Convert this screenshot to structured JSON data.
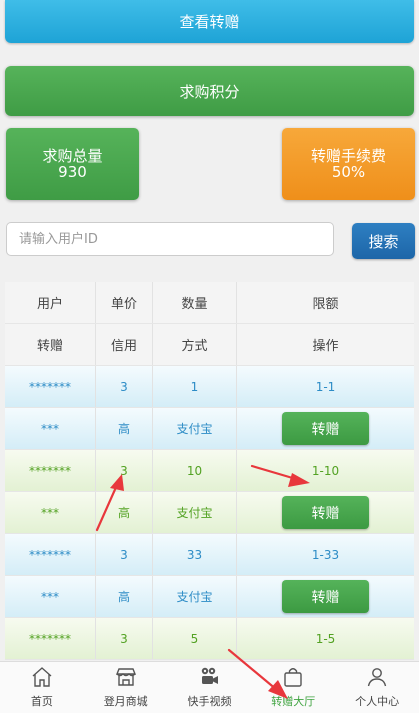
{
  "top": {
    "view_label": "查看转赠",
    "buy_label": "求购积分"
  },
  "cards": {
    "total_label": "求购总量",
    "total_value": "930",
    "fee_label": "转赠手续费",
    "fee_value": "50%"
  },
  "search": {
    "placeholder": "请输入用户ID",
    "button": "搜索"
  },
  "table": {
    "header1": [
      "用户",
      "单价",
      "数量",
      "限额"
    ],
    "header2": [
      "转赠",
      "信用",
      "方式",
      "操作"
    ],
    "entries": [
      {
        "user": "*******",
        "price": "3",
        "qty": "1",
        "limit": "1-1",
        "transfer": "***",
        "credit": "高",
        "method": "支付宝",
        "action": "转赠"
      },
      {
        "user": "*******",
        "price": "3",
        "qty": "10",
        "limit": "1-10",
        "transfer": "***",
        "credit": "高",
        "method": "支付宝",
        "action": "转赠"
      },
      {
        "user": "*******",
        "price": "3",
        "qty": "33",
        "limit": "1-33",
        "transfer": "***",
        "credit": "高",
        "method": "支付宝",
        "action": "转赠"
      },
      {
        "user": "*******",
        "price": "3",
        "qty": "5",
        "limit": "1-5"
      }
    ]
  },
  "tabbar": {
    "items": [
      "首页",
      "登月商城",
      "快手视频",
      "转赠大厅",
      "个人中心"
    ],
    "active_color": "#3ea33f"
  },
  "colors": {
    "blue_row_text": "#2d8cc6",
    "green_row_text": "#53a223",
    "annotation_arrow": "#e8373c"
  }
}
